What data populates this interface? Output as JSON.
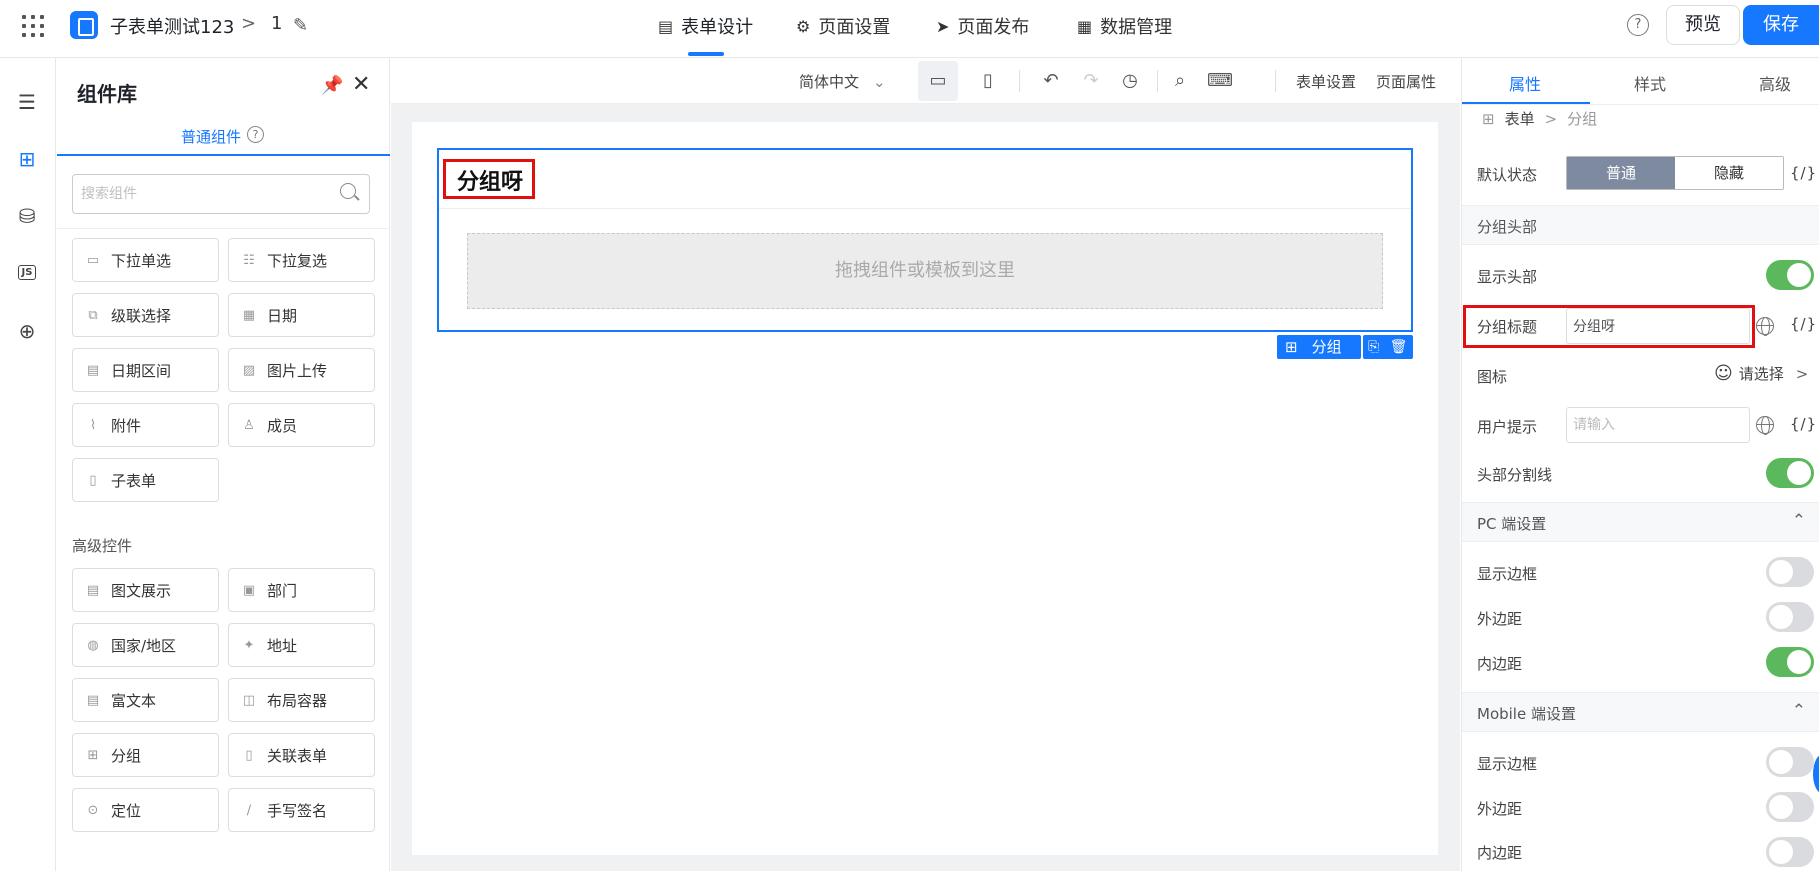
{
  "header": {
    "app_title": "子表单测试123",
    "crumb_sep": ">",
    "page_num": "1",
    "tabs": [
      {
        "label": "表单设计",
        "icon": "document-icon"
      },
      {
        "label": "页面设置",
        "icon": "gear-icon"
      },
      {
        "label": "页面发布",
        "icon": "send-icon"
      },
      {
        "label": "数据管理",
        "icon": "grid-icon"
      }
    ],
    "active_tab": 0,
    "help": "?",
    "preview_label": "预览",
    "save_label": "保存"
  },
  "left_nav": {
    "items": [
      "outline-icon",
      "components-icon",
      "datasource-icon",
      "js-icon",
      "globe-icon"
    ],
    "active": 1,
    "js_text": "JS"
  },
  "component_panel": {
    "title": "组件库",
    "tab_label": "普通组件",
    "search_placeholder": "搜索组件",
    "basic": [
      {
        "label": "下拉单选"
      },
      {
        "label": "下拉复选"
      },
      {
        "label": "级联选择"
      },
      {
        "label": "日期"
      },
      {
        "label": "日期区间"
      },
      {
        "label": "图片上传"
      },
      {
        "label": "附件"
      },
      {
        "label": "成员"
      },
      {
        "label": "子表单"
      }
    ],
    "advanced_title": "高级控件",
    "advanced": [
      {
        "label": "图文展示"
      },
      {
        "label": "部门"
      },
      {
        "label": "国家/地区"
      },
      {
        "label": "地址"
      },
      {
        "label": "富文本"
      },
      {
        "label": "布局容器"
      },
      {
        "label": "分组"
      },
      {
        "label": "关联表单"
      },
      {
        "label": "定位"
      },
      {
        "label": "手写签名"
      }
    ]
  },
  "toolbar": {
    "language": "简体中文",
    "form_settings": "表单设置",
    "page_props": "页面属性"
  },
  "canvas": {
    "group_title": "分组呀",
    "drop_hint": "拖拽组件或模板到这里",
    "group_tag": "分组"
  },
  "props_panel": {
    "tabs": [
      "属性",
      "样式",
      "高级"
    ],
    "active_tab": 0,
    "breadcrumb": [
      "表单",
      "分组"
    ],
    "default_state_label": "默认状态",
    "state_options": [
      "普通",
      "隐藏"
    ],
    "state_selected": 0,
    "code_icon_text": "{/}",
    "header_section": "分组头部",
    "show_header_label": "显示头部",
    "show_header": true,
    "group_title_label": "分组标题",
    "group_title_value": "分组呀",
    "icon_label": "图标",
    "icon_select": "请选择",
    "hint_label": "用户提示",
    "hint_placeholder": "请输入",
    "divider_label": "头部分割线",
    "divider": true,
    "pc_section": "PC 端设置",
    "mobile_section": "Mobile 端设置",
    "pc": {
      "border_label": "显示边框",
      "border": false,
      "margin_label": "外边距",
      "margin": false,
      "padding_label": "内边距",
      "padding": true
    },
    "mobile": {
      "border_label": "显示边框",
      "border": false,
      "margin_label": "外边距",
      "margin": false,
      "padding_label": "内边距",
      "padding": false
    }
  },
  "colors": {
    "accent": "#1677ff",
    "toggle_on": "#5cb85c",
    "highlight": "#e01010"
  }
}
